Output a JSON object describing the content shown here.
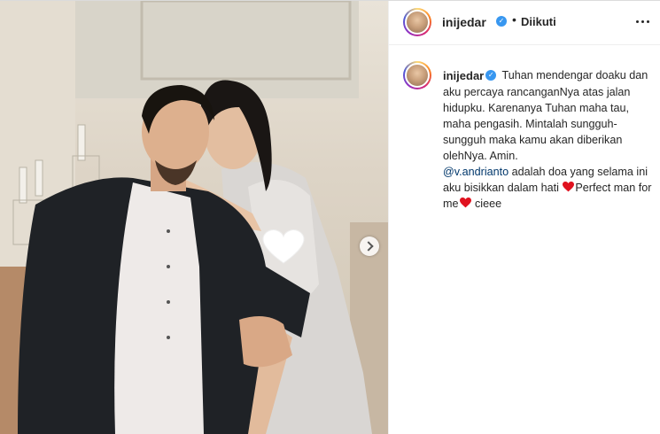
{
  "post": {
    "username": "inijedar",
    "verified": true,
    "follow_separator": "•",
    "follow_status": "Diikuti",
    "more_icon": "more-horizontal-icon",
    "carousel_icon": "chevron-right-icon"
  },
  "caption": {
    "username": "inijedar",
    "line1": "Tuhan mendengar doaku dan aku percaya rancanganNya atas jalan hidupku. Karenanya Tuhan maha tau, maha pengasih. Mintalah sungguh-sungguh maka kamu akan diberikan olehNya. Amin.",
    "mention": "@v.andrianto",
    "line2": "adalah doa yang selama ini aku bisikkan dalam hati",
    "line3": "Perfect man for me",
    "line4": "cieee",
    "heart_icon": "red-heart-emoji",
    "heart_color": "#e0121f"
  },
  "colors": {
    "verified_blue": "#3897f0",
    "mention_blue": "#00376b",
    "border": "#dbdbdb"
  }
}
